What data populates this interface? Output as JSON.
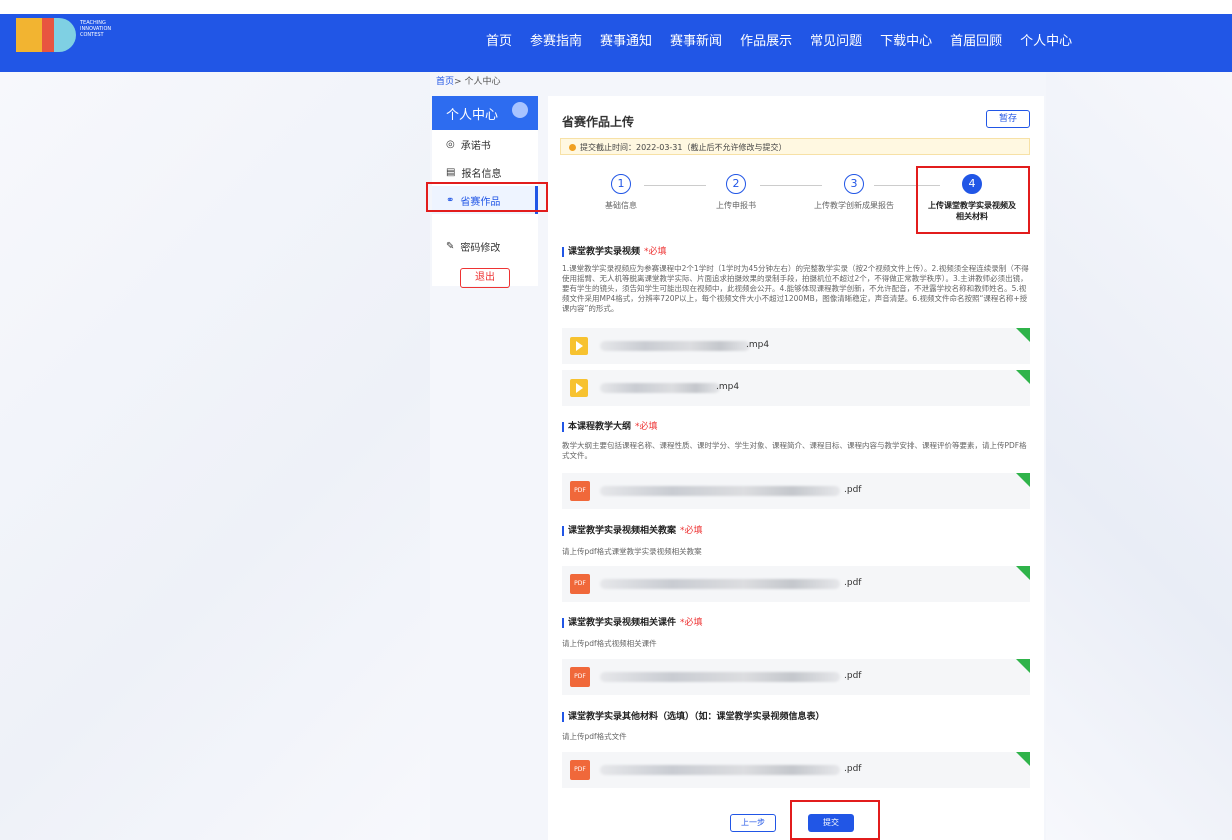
{
  "header": {
    "logo_text": "TEACHING INNOVATION CONTEST",
    "nav": [
      "首页",
      "参赛指南",
      "赛事通知",
      "赛事新闻",
      "作品展示",
      "常见问题",
      "下载中心",
      "首届回顾",
      "个人中心"
    ]
  },
  "breadcrumb": {
    "home": "首页",
    "separator": ">",
    "current": "个人中心"
  },
  "sidebar": {
    "title": "个人中心",
    "items": [
      "承诺书",
      "报名信息",
      "省赛作品",
      "密码修改"
    ],
    "logout": "退出"
  },
  "main": {
    "title": "省赛作品上传",
    "save": "暂存",
    "deadline": "提交截止时间：2022-03-31（截止后不允许修改与提交）",
    "steps": [
      {
        "num": "1",
        "label": "基础信息"
      },
      {
        "num": "2",
        "label": "上传申报书"
      },
      {
        "num": "3",
        "label": "上传教学创新成果报告"
      },
      {
        "num": "4",
        "label": "上传课堂教学实录视频及相关材料"
      }
    ],
    "sections": [
      {
        "title": "课堂教学实录视频",
        "req": "*必填",
        "desc": "1.课堂教学实录视频应为参赛课程中2个1学时（1学时为45分钟左右）的完整教学实录（按2个视频文件上传）。2.视频须全程连续录制（不得使用摇臂、无人机等脱离课堂教学实际、片面追求拍摄效果的录制手段，拍摄机位不超过2个，不得做正常教学秩序）。3.主讲教师必须出镜，要有学生的镜头，须告知学生可能出现在视频中，此视频会公开。4.能够体现课程教学创新，不允许配音，不泄露学校名称和教师姓名。5.视频文件采用MP4格式，分辨率720P以上，每个视频文件大小不超过1200MB，图像清晰稳定，声音清楚。6.视频文件命名按照“课程名称+授课内容”的形式。"
      },
      {
        "title": "本课程教学大纲",
        "req": "*必填",
        "desc": "教学大纲主要包括课程名称、课程性质、课时学分、学生对象、课程简介、课程目标、课程内容与教学安排、课程评价等要素，请上传PDF格式文件。"
      },
      {
        "title": "课堂教学实录视频相关教案",
        "req": "*必填",
        "desc": "请上传pdf格式课堂教学实录视频相关教案"
      },
      {
        "title": "课堂教学实录视频相关课件",
        "req": "*必填",
        "desc": "请上传pdf格式视频相关课件"
      },
      {
        "title": "课堂教学实录其他材料（选填）（如：课堂教学实录视频信息表）",
        "req": "",
        "desc": "请上传pdf格式文件"
      }
    ],
    "files": {
      "video1": ".mp4",
      "video2": ".mp4",
      "pdf_icon": "PDF",
      "pdf": ".pdf"
    },
    "prev": "上一步",
    "submit": "提交"
  }
}
